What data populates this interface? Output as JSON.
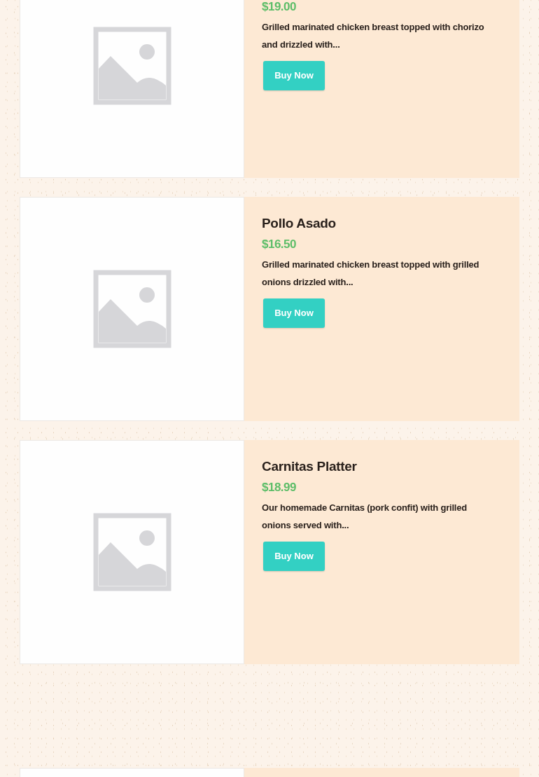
{
  "sections": [
    {
      "products": [
        {
          "kind": "product",
          "price": "$19.00",
          "description": "Grilled marinated chicken breast topped with chorizo and drizzled with...",
          "button": "Buy Now"
        },
        {
          "kind": "product",
          "name": "Pollo Asado",
          "price": "$16.50",
          "description": "Grilled marinated chicken breast topped with grilled onions drizzled with...",
          "button": "Buy Now"
        },
        {
          "kind": "product",
          "name": "Carnitas Platter",
          "price": "$18.99",
          "description": "Our homemade Carnitas (pork confit) with grilled onions served with...",
          "button": "Buy Now"
        }
      ]
    },
    {
      "products": [
        {
          "kind": "partial"
        }
      ]
    }
  ]
}
